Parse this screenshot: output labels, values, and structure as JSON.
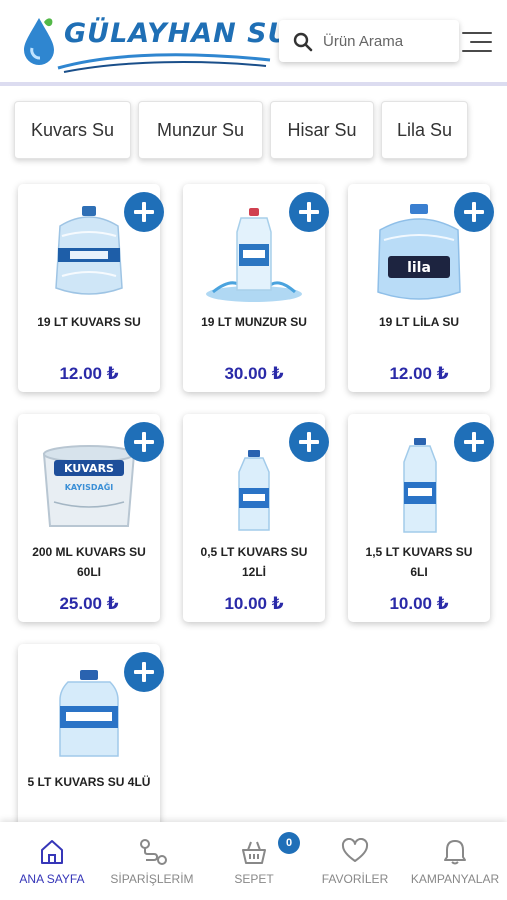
{
  "header": {
    "brand": "GÜLAYHAN SU",
    "search_placeholder": "Ürün Arama"
  },
  "categories": [
    {
      "label": "Kuvars Su"
    },
    {
      "label": "Munzur Su"
    },
    {
      "label": "Hisar Su"
    },
    {
      "label": "Lila Su"
    }
  ],
  "products": [
    {
      "name": "19 LT KUVARS SU",
      "price": "12.00 ₺",
      "image": "19lt-kuvars-carboy"
    },
    {
      "name": "19 LT MUNZUR SU",
      "price": "30.00 ₺",
      "image": "19lt-munzur-bottle-splash"
    },
    {
      "name": "19 LT LİLA SU",
      "price": "12.00 ₺",
      "image": "19lt-lila-carboy"
    },
    {
      "name": "200 ML KUVARS SU 60LI",
      "price": "25.00 ₺",
      "image": "200ml-kuvars-cup"
    },
    {
      "name": "0,5 LT KUVARS SU 12Lİ",
      "price": "10.00 ₺",
      "image": "0-5lt-kuvars-bottle"
    },
    {
      "name": "1,5 LT KUVARS SU 6LI",
      "price": "10.00 ₺",
      "image": "1-5lt-kuvars-bottle"
    },
    {
      "name": "5 LT KUVARS SU 4LÜ",
      "price": "",
      "image": "5lt-kuvars-jug"
    }
  ],
  "product_images": {
    "cup_label": "KUVARS",
    "cup_sub": "KAYISDAĞI",
    "lila_label": "lila"
  },
  "bottom_nav": [
    {
      "label": "ANA SAYFA",
      "icon": "home-icon",
      "active": true
    },
    {
      "label": "SİPARİŞLERİM",
      "icon": "route-icon",
      "active": false
    },
    {
      "label": "SEPET",
      "icon": "basket-icon",
      "active": false,
      "badge": "0"
    },
    {
      "label": "FAVORİLER",
      "icon": "heart-icon",
      "active": false
    },
    {
      "label": "KAMPANYALAR",
      "icon": "bell-icon",
      "active": false
    }
  ],
  "colors": {
    "accent": "#1f6fb8",
    "price": "#2a2aa8",
    "nav_active": "#3636b8",
    "divider": "#dcdcf0"
  }
}
